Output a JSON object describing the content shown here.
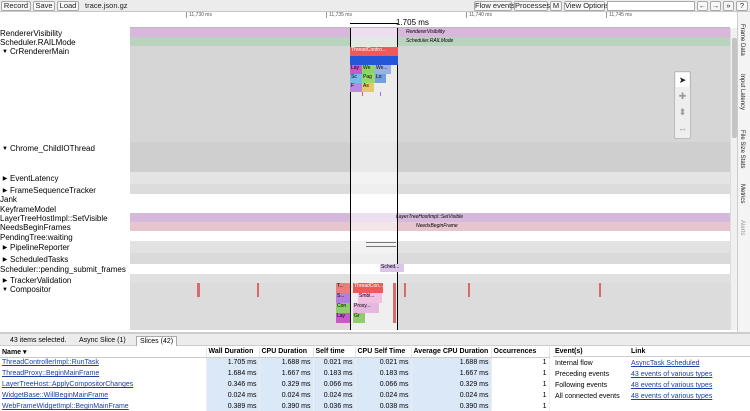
{
  "toolbar": {
    "record": "Record",
    "save": "Save",
    "load": "Load",
    "file_name": "trace.json.gz",
    "flow_events": "Flow events",
    "processes": "Processes",
    "m": "M",
    "view_options": "View Options",
    "nav_back": "←",
    "nav_forward": "→",
    "more": "»",
    "help": "?"
  },
  "ruler": {
    "ticks": [
      "11,730 ms",
      "11,735 ms",
      "11,740 ms",
      "11,745 ms"
    ],
    "selection_duration": "1.705 ms"
  },
  "side_tabs": [
    "Frame Data",
    "Input Latency",
    "File Size Stats",
    "Metrics",
    "Alerts"
  ],
  "tracks": {
    "renderer_visibility": "RendererVisibility",
    "rail_mode": "Scheduler.RAILMode",
    "cr_renderer_main": "CrRendererMain",
    "child_io": "Chrome_ChildIOThread",
    "event_latency": "EventLatency",
    "frame_seq": "FrameSequenceTracker",
    "jank": "Jank",
    "keyframe": "KeyframeModel",
    "lth_visible": "LayerTreeHostImpl::SetVisible",
    "needs_begin": "NeedsBeginFrames",
    "pending_tree": "PendingTree:waiting",
    "pipeline": "PipelineReporter",
    "scheduled_tasks": "ScheduledTasks",
    "pending_submit": "Scheduler::pending_submit_frames",
    "tracker_validation": "TrackerValidation",
    "compositor": "Compositor"
  },
  "slices": {
    "renderer_visibility": "RendererVisibility",
    "rail_mode": "Scheduler.RAILMode",
    "thread_controller": "ThreadContro...",
    "lay": "Lay",
    "we": "We",
    "we2": "We...",
    "sc": "Sc",
    "pag": "Pag",
    "lo": "Lo",
    "f": "F",
    "as": "As",
    "lth_visible": "LayerTreeHostImpl::SetVisible",
    "needs_begin": "NeedsBeginFrame",
    "sched": "Sched...",
    "comp_t": "T...",
    "comp_tc": "ThreadCon...",
    "comp_s": "S...",
    "comp_smbl": "Smbl...",
    "comp_con": "Con",
    "comp_proxy": "Proxy...",
    "comp_lay": "Lay",
    "comp_gr": "Gr"
  },
  "panel": {
    "selection_count": "43 items selected.",
    "tab_async": "Async Slice (1)",
    "tab_slices": "Slices (42)",
    "columns": [
      "Name",
      "Wall Duration",
      "CPU Duration",
      "Self time",
      "CPU Self Time",
      "Average CPU Duration",
      "Occurrences"
    ],
    "rows": [
      [
        "ThreadControllerImpl::RunTask",
        "1.705 ms",
        "1.688 ms",
        "0.021 ms",
        "0.021 ms",
        "1.688 ms",
        "1"
      ],
      [
        "ThreadProxy::BeginMainFrame",
        "1.684 ms",
        "1.667 ms",
        "0.183 ms",
        "0.183 ms",
        "1.667 ms",
        "1"
      ],
      [
        "LayerTreeHost::ApplyCompositorChanges",
        "0.346 ms",
        "0.329 ms",
        "0.066 ms",
        "0.066 ms",
        "0.329 ms",
        "1"
      ],
      [
        "WidgetBase::WillBeginMainFrame",
        "0.024 ms",
        "0.024 ms",
        "0.024 ms",
        "0.024 ms",
        "0.024 ms",
        "1"
      ],
      [
        "WebFrameWidgetImpl::BeginMainFrame",
        "0.389 ms",
        "0.390 ms",
        "0.036 ms",
        "0.038 ms",
        "0.390 ms",
        "1"
      ]
    ],
    "events_header": "Event(s)",
    "link_header": "Link",
    "events": [
      [
        "Internal flow",
        "AsyncTask Scheduled"
      ],
      [
        "Preceding events",
        "43 events of various types"
      ],
      [
        "Following events",
        "48 events of various types"
      ],
      [
        "All connected events",
        "48 events of various types"
      ]
    ]
  }
}
